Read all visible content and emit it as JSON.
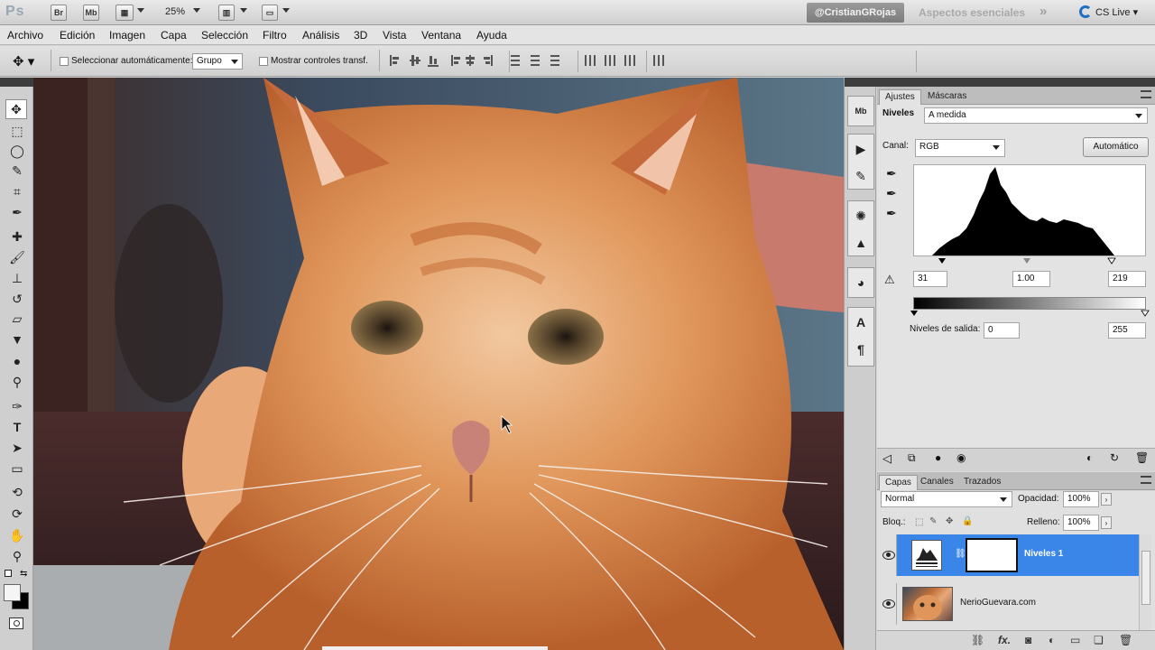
{
  "app": {
    "logo": "Ps",
    "bridge": "Br",
    "minibridge": "Mb",
    "zoom": "25%",
    "workspace_user": "@CristianGRojas",
    "workspace_name": "Aspectos esenciales",
    "more": "»",
    "cs_live": "CS Live"
  },
  "menu": [
    "Archivo",
    "Edición",
    "Imagen",
    "Capa",
    "Selección",
    "Filtro",
    "Análisis",
    "3D",
    "Vista",
    "Ventana",
    "Ayuda"
  ],
  "options": {
    "auto_select_label": "Seleccionar automáticamente:",
    "auto_select_value": "Grupo",
    "transform_label": "Mostrar controles transf."
  },
  "adjustments": {
    "tab_adjust": "Ajustes",
    "tab_masks": "Máscaras",
    "title": "Niveles",
    "preset": "A medida",
    "channel_label": "Canal:",
    "channel": "RGB",
    "auto_button": "Automático",
    "input_shadow": "31",
    "input_mid": "1.00",
    "input_highlight": "219",
    "output_label": "Niveles de salida:",
    "output_low": "0",
    "output_high": "255"
  },
  "layers": {
    "tab_layers": "Capas",
    "tab_channels": "Canales",
    "tab_paths": "Trazados",
    "blend_mode": "Normal",
    "opacity_label": "Opacidad:",
    "opacity": "100%",
    "lock_label": "Bloq.:",
    "fill_label": "Relleno:",
    "fill": "100%",
    "items": [
      {
        "name": "Niveles 1",
        "selected": true
      },
      {
        "name": "NerioGuevara.com",
        "selected": false
      }
    ]
  },
  "icons": {
    "tools": [
      "move-icon",
      "marquee-icon",
      "lasso-icon",
      "quick-select-icon",
      "crop-icon",
      "eyedropper-icon",
      "healing-icon",
      "brush-icon",
      "stamp-icon",
      "history-brush-icon",
      "eraser-icon",
      "bucket-icon",
      "blur-icon",
      "dodge-icon",
      "pen-icon",
      "type-icon",
      "path-select-icon",
      "shape-icon",
      "3d-rotate-icon",
      "3d-orbit-icon",
      "hand-icon",
      "zoom-icon"
    ]
  },
  "colors": {
    "selection_blue": "#3a86e8",
    "dark_header": "#3d3d3d"
  }
}
